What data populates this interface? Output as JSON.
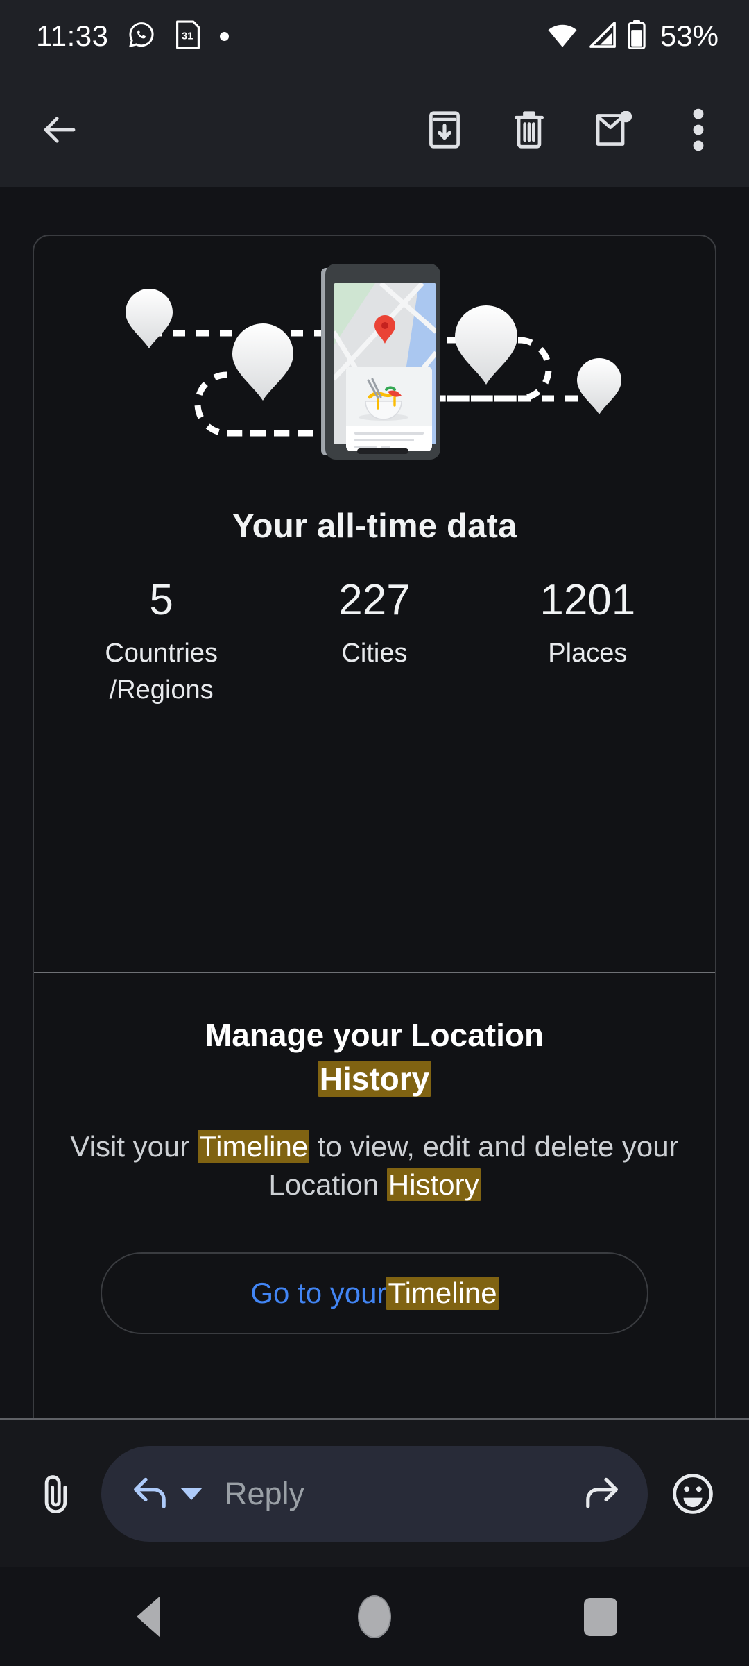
{
  "statusbar": {
    "time": "11:33",
    "icons": [
      "whatsapp-icon",
      "calendar-icon",
      "notification-dot"
    ],
    "calendar_day": "31",
    "wifi": "wifi-icon",
    "signal": "cell-signal-icon",
    "battery_percent": "53%"
  },
  "toolbar": {
    "back_label": "Back",
    "archive_label": "Archive",
    "delete_label": "Delete",
    "unread_label": "Mark as unread",
    "more_label": "More options"
  },
  "message": {
    "illustration": {
      "alt": "Phone showing map with location pin and food place card, surrounded by location pins connected by dashed travel path"
    },
    "alltime": {
      "title": "Your all-time data",
      "stats": [
        {
          "value": "5",
          "label": "Countries\n/Regions"
        },
        {
          "value": "227",
          "label": "Cities"
        },
        {
          "value": "1201",
          "label": "Places"
        }
      ]
    },
    "manage": {
      "title_pre": "Manage your Location",
      "title_mark": "History",
      "body_1": "Visit your ",
      "body_mark_1": "Timeline",
      "body_2": " to view, edit and delete your Location ",
      "body_mark_2": "History",
      "cta_pre": "Go to your ",
      "cta_mark": "Timeline"
    }
  },
  "reply": {
    "attach_label": "Attach file",
    "reply_icon": "reply-arrow-icon",
    "placeholder": "Reply",
    "forward_icon": "forward-arrow-icon",
    "emoji_label": "Insert emoji"
  },
  "navbar": {
    "back_label": "Back",
    "home_label": "Home",
    "recents_label": "Recent apps"
  },
  "colors": {
    "highlight": "#806312",
    "link": "#4285f4",
    "statusbar_bg": "#1f2126",
    "page_bg": "#121317",
    "pill_bg": "#282b38"
  }
}
